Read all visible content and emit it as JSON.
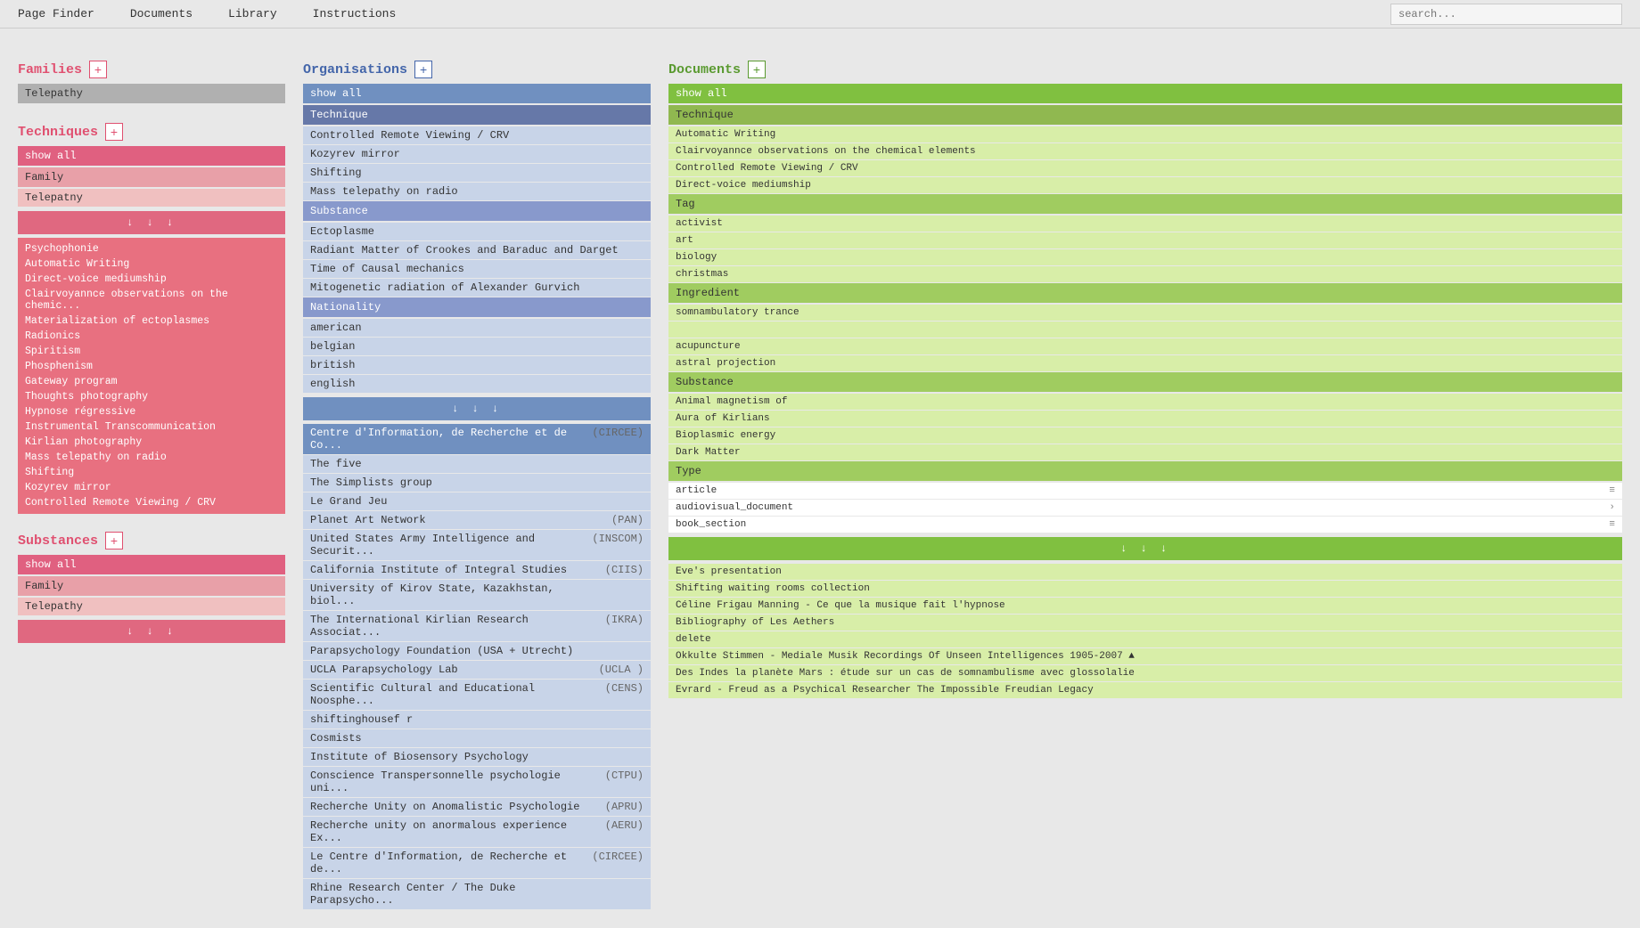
{
  "nav": {
    "items": [
      "Page Finder",
      "Documents",
      "Library",
      "Instructions"
    ],
    "search_placeholder": "search..."
  },
  "page_title": "Telepathy",
  "families": {
    "title": "Families",
    "add_label": "+",
    "active_tag": "Telepathy"
  },
  "techniques": {
    "title": "Techniques",
    "add_label": "+",
    "show_all": "show all",
    "sub_header": "Family",
    "sub_item": "Telepatny",
    "arrows": "↓ ↓ ↓",
    "list": [
      "Psychophonie",
      "Automatic Writing",
      "Direct-voice mediumship",
      "Clairvoyannce observations on the chemic...",
      "Materialization of ectoplasmes",
      "Radionics",
      "Spiritism",
      "Phosphenism",
      "Gateway program",
      "Thoughts photography",
      "Hypnose régressive",
      "Instrumental Transcommunication",
      "Kirlian photography",
      "Mass telepathy on radio",
      "Shifting",
      "Kozyrev mirror",
      "Controlled Remote Viewing / CRV"
    ]
  },
  "substances": {
    "title": "Substances",
    "add_label": "+",
    "show_all": "show all",
    "sub_header": "Family",
    "sub_item": "Telepathy",
    "arrows": "↓ ↓ ↓"
  },
  "organisations": {
    "title": "Organisations",
    "add_label": "+",
    "show_all": "show all",
    "sub_header_technique": "Technique",
    "section_controlled": "Controlled Remote Viewing / CRV",
    "section_kozyrev": "Kozyrev mirror",
    "section_shifting": "Shifting",
    "section_mass": "Mass telepathy on radio",
    "sub_header_substance": "Substance",
    "sub_section_ectoplasme": "Ectoplasme",
    "sub_section_radiant": "Radiant Matter of Crookes and Baraduc and Darget",
    "sub_section_time": "Time of Causal mechanics",
    "sub_section_mito": "Mitogenetic radiation of Alexander Gurvich",
    "sub_header_nationality": "Nationality",
    "nationality_american": "american",
    "nationality_belgian": "belgian",
    "nationality_british": "british",
    "nationality_english": "english",
    "arrows": "↓ ↓ ↓",
    "orgs": [
      {
        "name": "Centre d'Information, de Recherche et de Co...",
        "abbr": "(CIRCEE)",
        "selected": true
      },
      {
        "name": "The five",
        "abbr": "",
        "selected": false
      },
      {
        "name": "The Simplists group",
        "abbr": "",
        "selected": false
      },
      {
        "name": "Le Grand Jeu",
        "abbr": "",
        "selected": false
      },
      {
        "name": "Planet Art Network",
        "abbr": "(PAN)",
        "selected": false
      },
      {
        "name": "United States Army Intelligence and Securit...",
        "abbr": "(INSCOM)",
        "selected": false
      },
      {
        "name": "California Institute of Integral Studies",
        "abbr": "(CIIS)",
        "selected": false
      },
      {
        "name": "University of Kirov State, Kazakhstan, biol...",
        "abbr": "",
        "selected": false
      },
      {
        "name": "The International Kirlian Research Associat...",
        "abbr": "(IKRA)",
        "selected": false
      },
      {
        "name": "Parapsychology Foundation (USA + Utrecht)",
        "abbr": "",
        "selected": false
      },
      {
        "name": "UCLA Parapsychology Lab",
        "abbr": "(UCLA )",
        "selected": false
      },
      {
        "name": "Scientific Cultural and Educational Noosphe...",
        "abbr": "(CENS)",
        "selected": false
      },
      {
        "name": "shiftinghousef r",
        "abbr": "",
        "selected": false
      },
      {
        "name": "Cosmists",
        "abbr": "",
        "selected": false
      },
      {
        "name": "Institute of Biosensory Psychology",
        "abbr": "",
        "selected": false
      },
      {
        "name": "Conscience Transpersonnelle psychologie uni...",
        "abbr": "(CTPU)",
        "selected": false
      },
      {
        "name": "Recherche Unity on Anomalistic Psychologie",
        "abbr": "(APRU)",
        "selected": false
      },
      {
        "name": "Recherche unity on anormalous experience Ex...",
        "abbr": "(AERU)",
        "selected": false
      },
      {
        "name": "Le Centre d'Information, de Recherche et de...",
        "abbr": "(CIRCEE)",
        "selected": false
      },
      {
        "name": "Rhine Research Center / The Duke Parapsycho...",
        "abbr": "",
        "selected": false
      }
    ]
  },
  "documents": {
    "title": "Documents",
    "add_label": "+",
    "show_all": "show all",
    "sub_header_technique": "Technique",
    "technique_items": [
      "Automatic Writing",
      "Clairvoyannce observations on the chemical elements",
      "Controlled Remote Viewing / CRV",
      "Direct-voice mediumship"
    ],
    "sub_header_tag": "Tag",
    "tag_items": [
      "activist",
      "art",
      "biology",
      "christmas"
    ],
    "sub_header_ingredient": "Ingredient",
    "ingredient_items": [
      "somnambulatory trance",
      "",
      "acupuncture",
      "astral projection"
    ],
    "sub_header_substance": "Substance",
    "substance_items": [
      "Animal magnetism of",
      "Aura of Kirlians",
      "Bioplasmic energy",
      "Dark Matter"
    ],
    "sub_header_type": "Type",
    "type_items": [
      "article",
      "audiovisual_document",
      "book_section"
    ],
    "arrows": "↓ ↓ ↓",
    "final_items": [
      "Eve's presentation",
      "Shifting waiting rooms collection",
      "Céline Frigau Manning - Ce que la musique fait l'hypnose",
      "Bibliography of Les Aethers",
      "delete",
      "Okkulte Stimmen - Mediale Musik Recordings Of Unseen Intelligences 1905-2007 ▲",
      "Des Indes la planète Mars : étude sur un cas de somnambulisme avec glossolalie",
      "Evrard - Freud as a Psychical Researcher The Impossible Freudian Legacy"
    ]
  }
}
